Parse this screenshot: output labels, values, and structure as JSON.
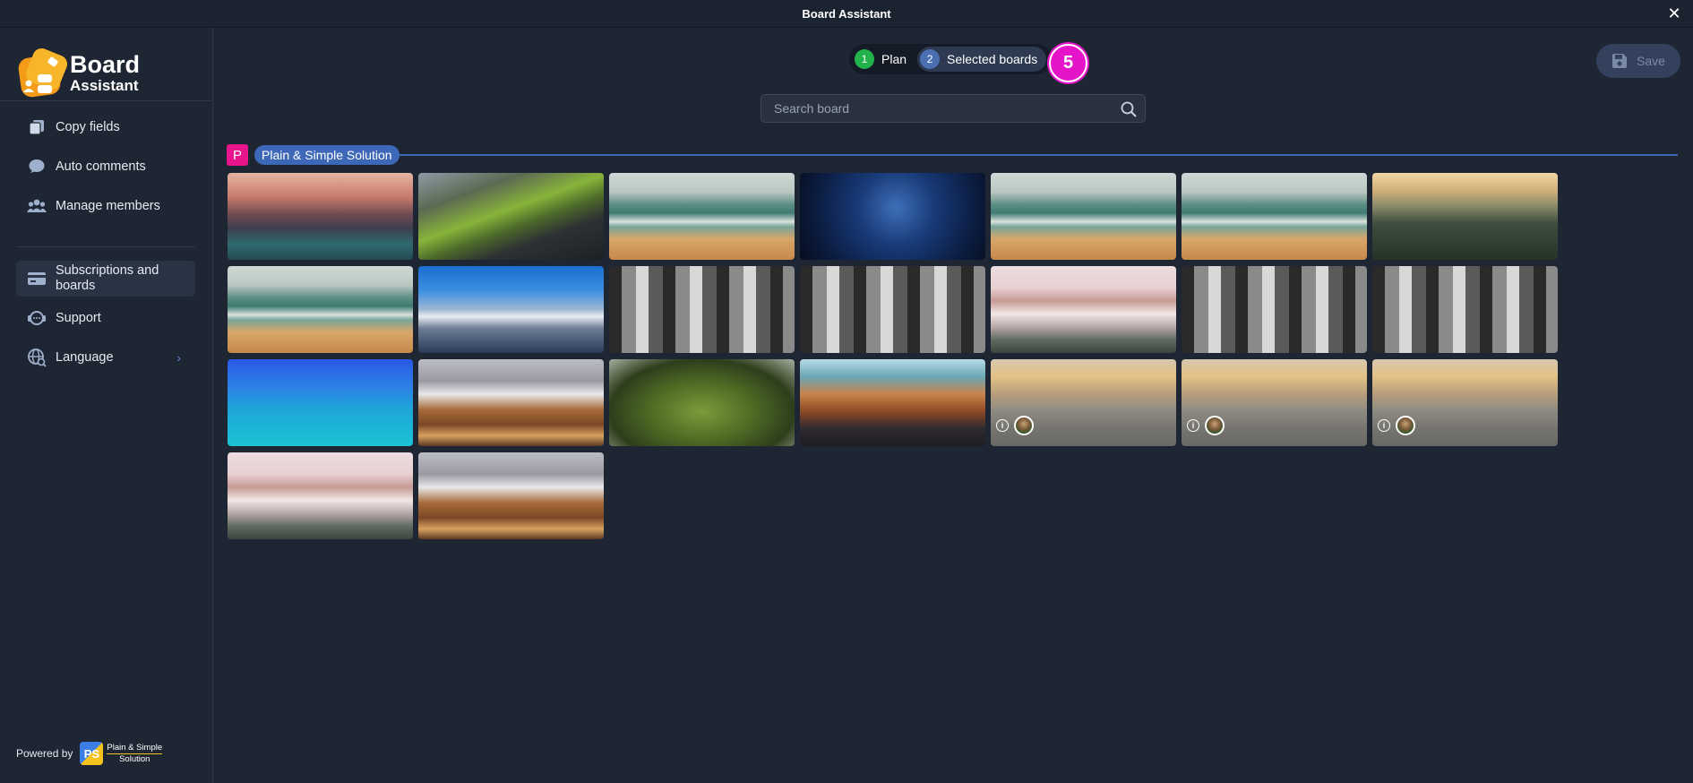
{
  "window": {
    "title": "Board Assistant"
  },
  "sidebar": {
    "logo": {
      "line1": "Board",
      "line2": "Assistant"
    },
    "items": [
      {
        "label": "Copy fields",
        "icon": "copy-icon"
      },
      {
        "label": "Auto comments",
        "icon": "comment-icon"
      },
      {
        "label": "Manage members",
        "icon": "members-icon"
      },
      {
        "label": "Subscriptions and boards",
        "icon": "card-icon",
        "active": true
      },
      {
        "label": "Support",
        "icon": "support-icon"
      },
      {
        "label": "Language",
        "icon": "globe-icon",
        "has_chevron": true
      }
    ],
    "powered_by": {
      "label": "Powered by",
      "brand_initials": "PS",
      "brand_line1": "Plain & Simple",
      "brand_line2": "Solution"
    }
  },
  "stepper": {
    "steps": [
      {
        "num": "1",
        "label": "Plan"
      },
      {
        "num": "2",
        "label": "Selected boards"
      }
    ],
    "count_badge": "5"
  },
  "toolbar": {
    "save_label": "Save"
  },
  "search": {
    "placeholder": "Search board"
  },
  "group": {
    "initial": "P",
    "name": "Plain & Simple Solution"
  },
  "boards": [
    {
      "bg": "mountain-sunset",
      "member": false
    },
    {
      "bg": "green-island",
      "member": false
    },
    {
      "bg": "beach",
      "member": false
    },
    {
      "bg": "night-sky",
      "member": false
    },
    {
      "bg": "beach",
      "member": false
    },
    {
      "bg": "beach",
      "member": false
    },
    {
      "bg": "forest-sunset",
      "member": false
    },
    {
      "bg": "beach",
      "member": false
    },
    {
      "bg": "snow-mountain",
      "member": false
    },
    {
      "bg": "bw-city",
      "member": false
    },
    {
      "bg": "bw-city",
      "member": false
    },
    {
      "bg": "pink-clouds",
      "member": false
    },
    {
      "bg": "bw-city",
      "member": false
    },
    {
      "bg": "bw-city",
      "member": false
    },
    {
      "bg": "blue-gradient",
      "member": false
    },
    {
      "bg": "rocky-snow",
      "member": false
    },
    {
      "bg": "green-valley",
      "member": false
    },
    {
      "bg": "canyon",
      "member": false
    },
    {
      "bg": "sand-dune",
      "member": true
    },
    {
      "bg": "sand-dune",
      "member": true
    },
    {
      "bg": "sand-dune",
      "member": true
    },
    {
      "bg": "pink-clouds",
      "member": false
    },
    {
      "bg": "rocky-snow",
      "member": false
    }
  ],
  "colors": {
    "accent": "#3d67b7",
    "step_done": "#22b24c",
    "badge": "#e514c9",
    "group_initial": "#e8148c"
  }
}
